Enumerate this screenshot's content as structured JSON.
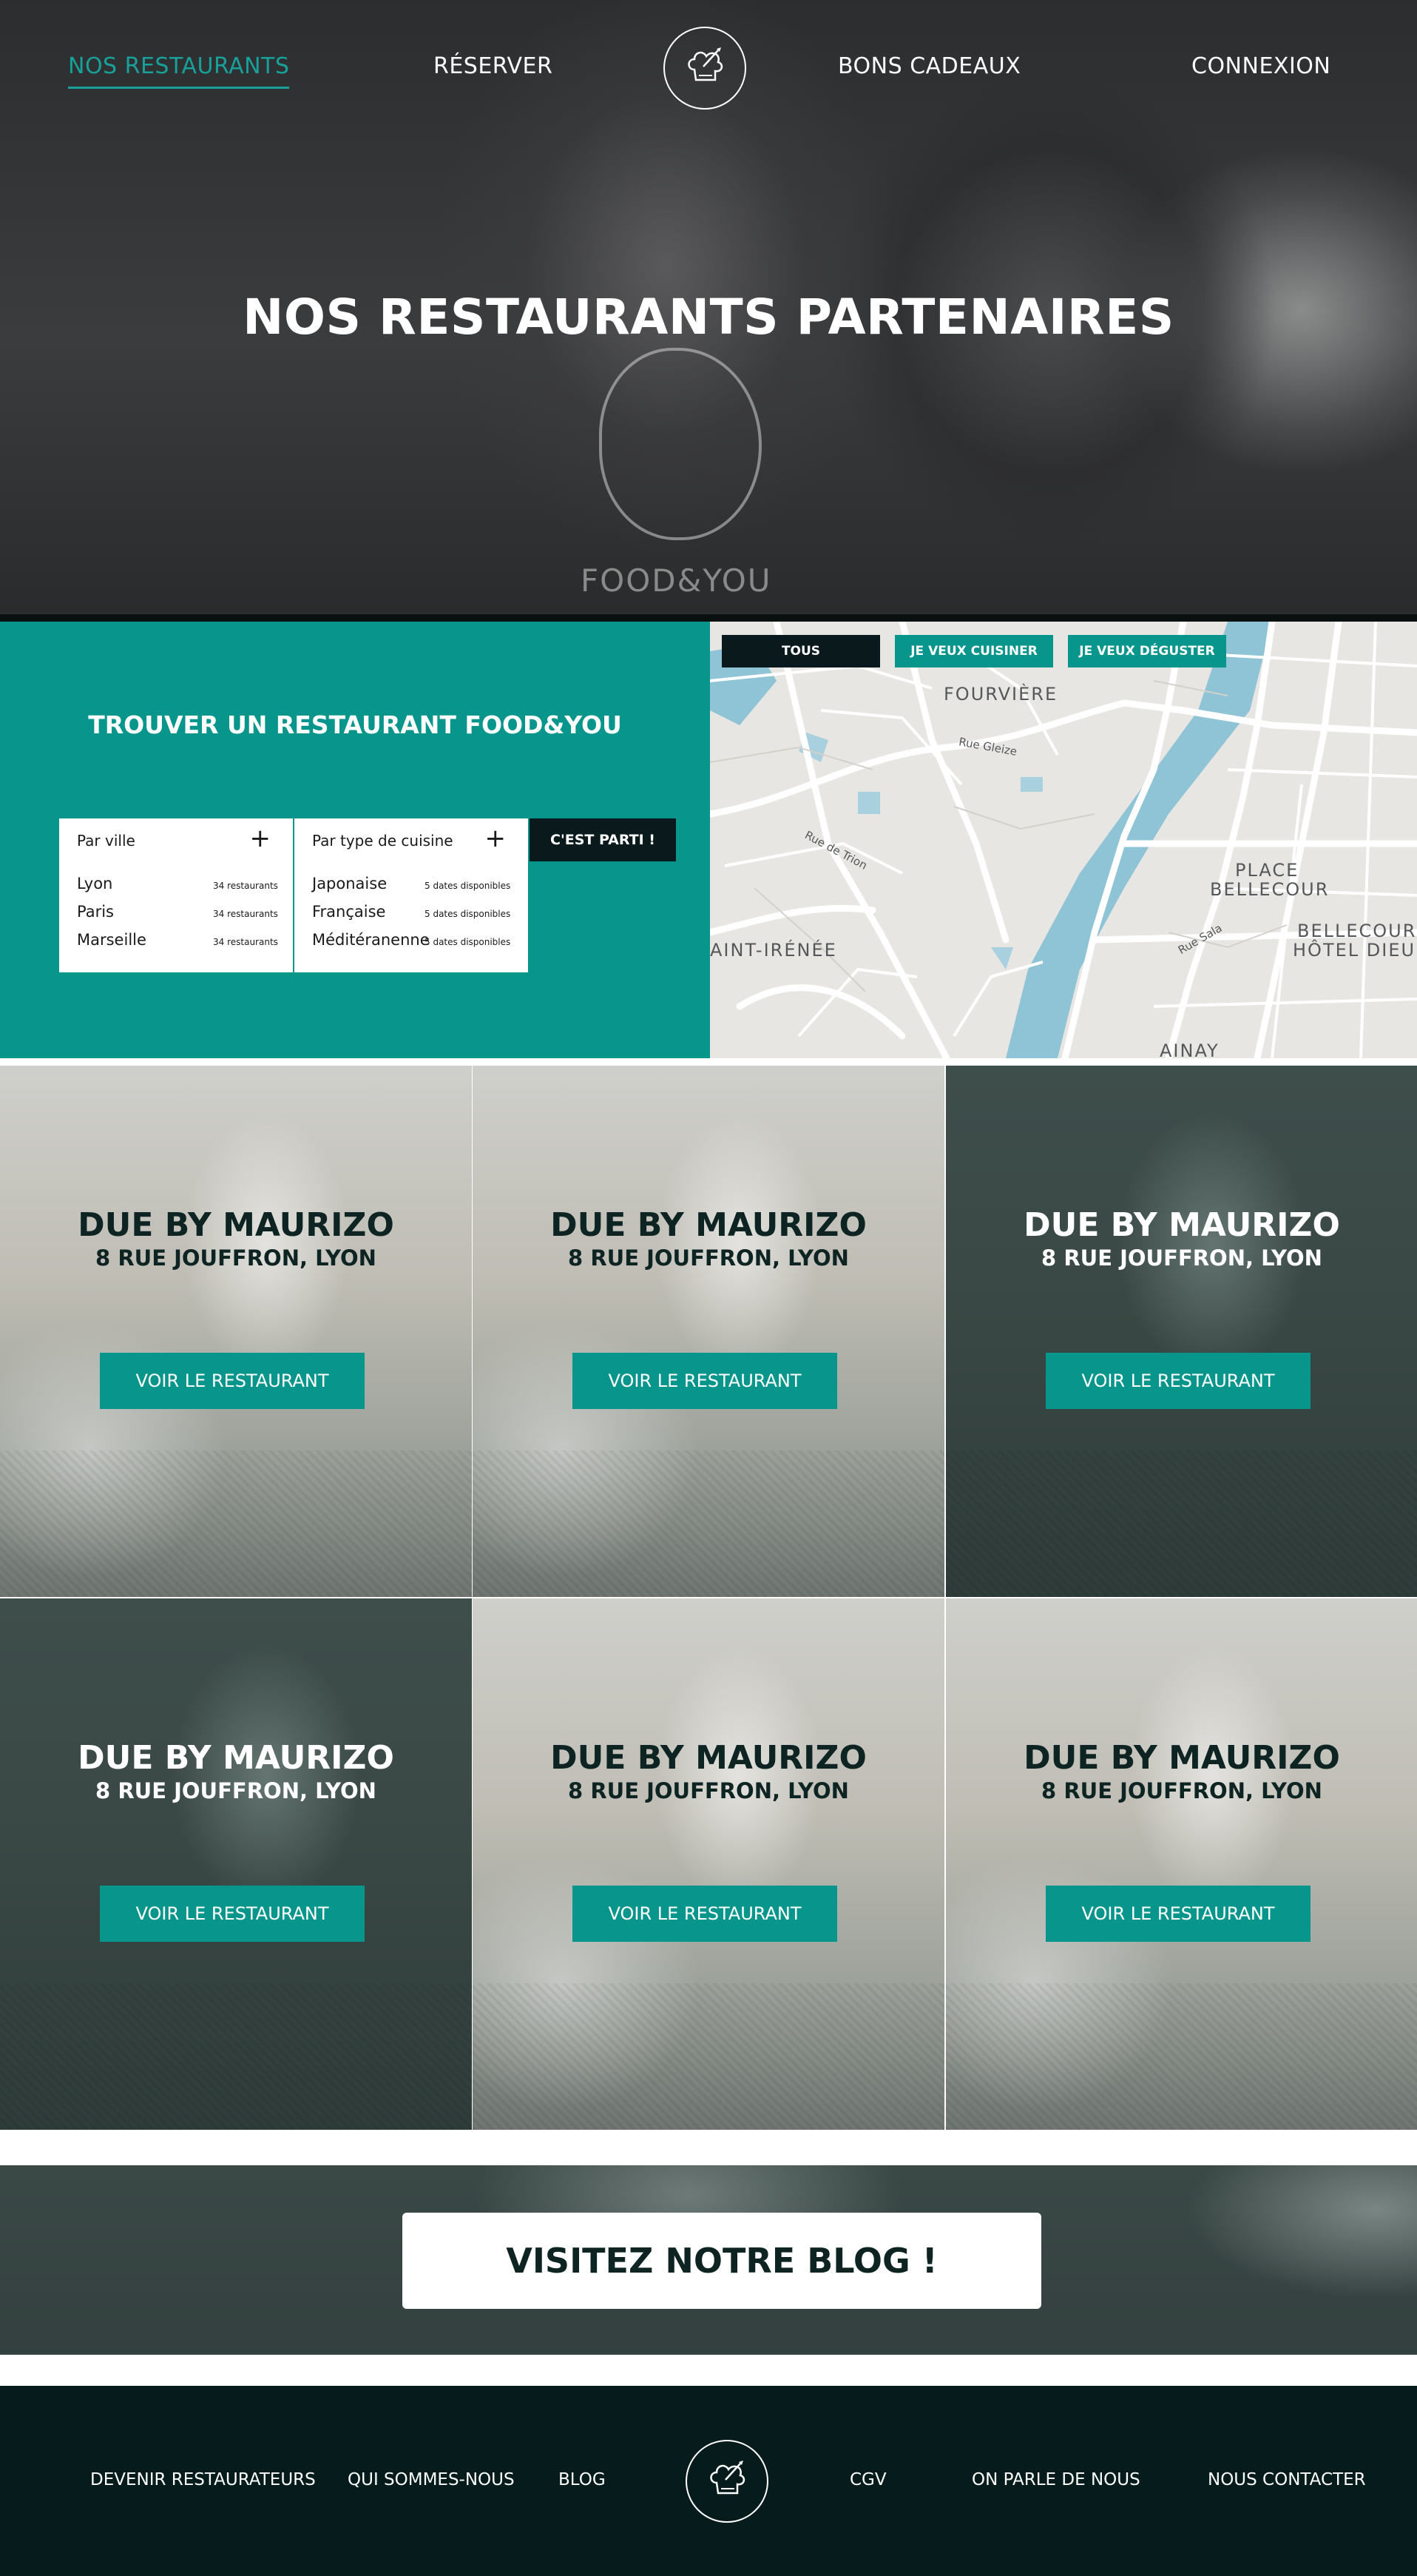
{
  "nav": {
    "restaurants": "NOS RESTAURANTS",
    "reserver": "RÉSERVER",
    "gift_cards": "BONS CADEAUX",
    "login": "CONNEXION"
  },
  "hero": {
    "title": "NOS RESTAURANTS PARTENAIRES",
    "apron_text": "FOOD&YOU"
  },
  "search": {
    "title": "TROUVER UN RESTAURANT FOOD&YOU",
    "by_city": {
      "label": "Par ville",
      "items": [
        {
          "name": "Lyon",
          "meta": "34 restaurants"
        },
        {
          "name": "Paris",
          "meta": "34 restaurants"
        },
        {
          "name": "Marseille",
          "meta": "34 restaurants"
        }
      ]
    },
    "by_cuisine": {
      "label": "Par type de cuisine",
      "items": [
        {
          "name": "Japonaise",
          "meta": "5 dates disponibles"
        },
        {
          "name": "Française",
          "meta": "5 dates disponibles"
        },
        {
          "name": "Méditéranenne",
          "meta": "5 dates disponibles"
        }
      ]
    },
    "go_button": "C'EST PARTI !"
  },
  "map": {
    "filters": [
      "TOUS",
      "JE VEUX CUISINER",
      "JE VEUX DÉGUSTER"
    ],
    "labels": {
      "fourviere": "FOURVIÈRE",
      "bellecour1": "PLACE",
      "bellecour2": "BELLECOUR",
      "bellecour_hotel1": "BELLECOUR",
      "bellecour_hotel2": "HÔTEL DIEU",
      "saint_irenee": "AINT-IRÉNÉE",
      "ainay": "AINAY",
      "rue_gleize": "Rue Gleize",
      "rue_trion": "Rue de Trion",
      "rue_sala": "Rue Sala"
    }
  },
  "restaurants": [
    {
      "name": "DUE BY MAURIZO",
      "address": "8 RUE JOUFFRON, LYON",
      "button": "VOIR LE RESTAURANT"
    },
    {
      "name": "DUE BY MAURIZO",
      "address": "8 RUE JOUFFRON, LYON",
      "button": "VOIR LE RESTAURANT"
    },
    {
      "name": "DUE BY MAURIZO",
      "address": "8 RUE JOUFFRON, LYON",
      "button": "VOIR LE RESTAURANT"
    },
    {
      "name": "DUE BY MAURIZO",
      "address": "8 RUE JOUFFRON, LYON",
      "button": "VOIR LE RESTAURANT"
    },
    {
      "name": "DUE BY MAURIZO",
      "address": "8 RUE JOUFFRON, LYON",
      "button": "VOIR LE RESTAURANT"
    },
    {
      "name": "DUE BY MAURIZO",
      "address": "8 RUE JOUFFRON, LYON",
      "button": "VOIR LE RESTAURANT"
    }
  ],
  "blog": {
    "button": "VISITEZ NOTRE BLOG !"
  },
  "footer": {
    "links": [
      "DEVENIR RESTAURATEURS",
      "QUI SOMMES-NOUS",
      "BLOG",
      "CGV",
      "ON PARLE DE NOUS",
      "NOUS CONTACTER"
    ]
  },
  "colors": {
    "teal": "#08958b",
    "dark": "#051b1c",
    "button_dark": "#0a1a1c"
  }
}
